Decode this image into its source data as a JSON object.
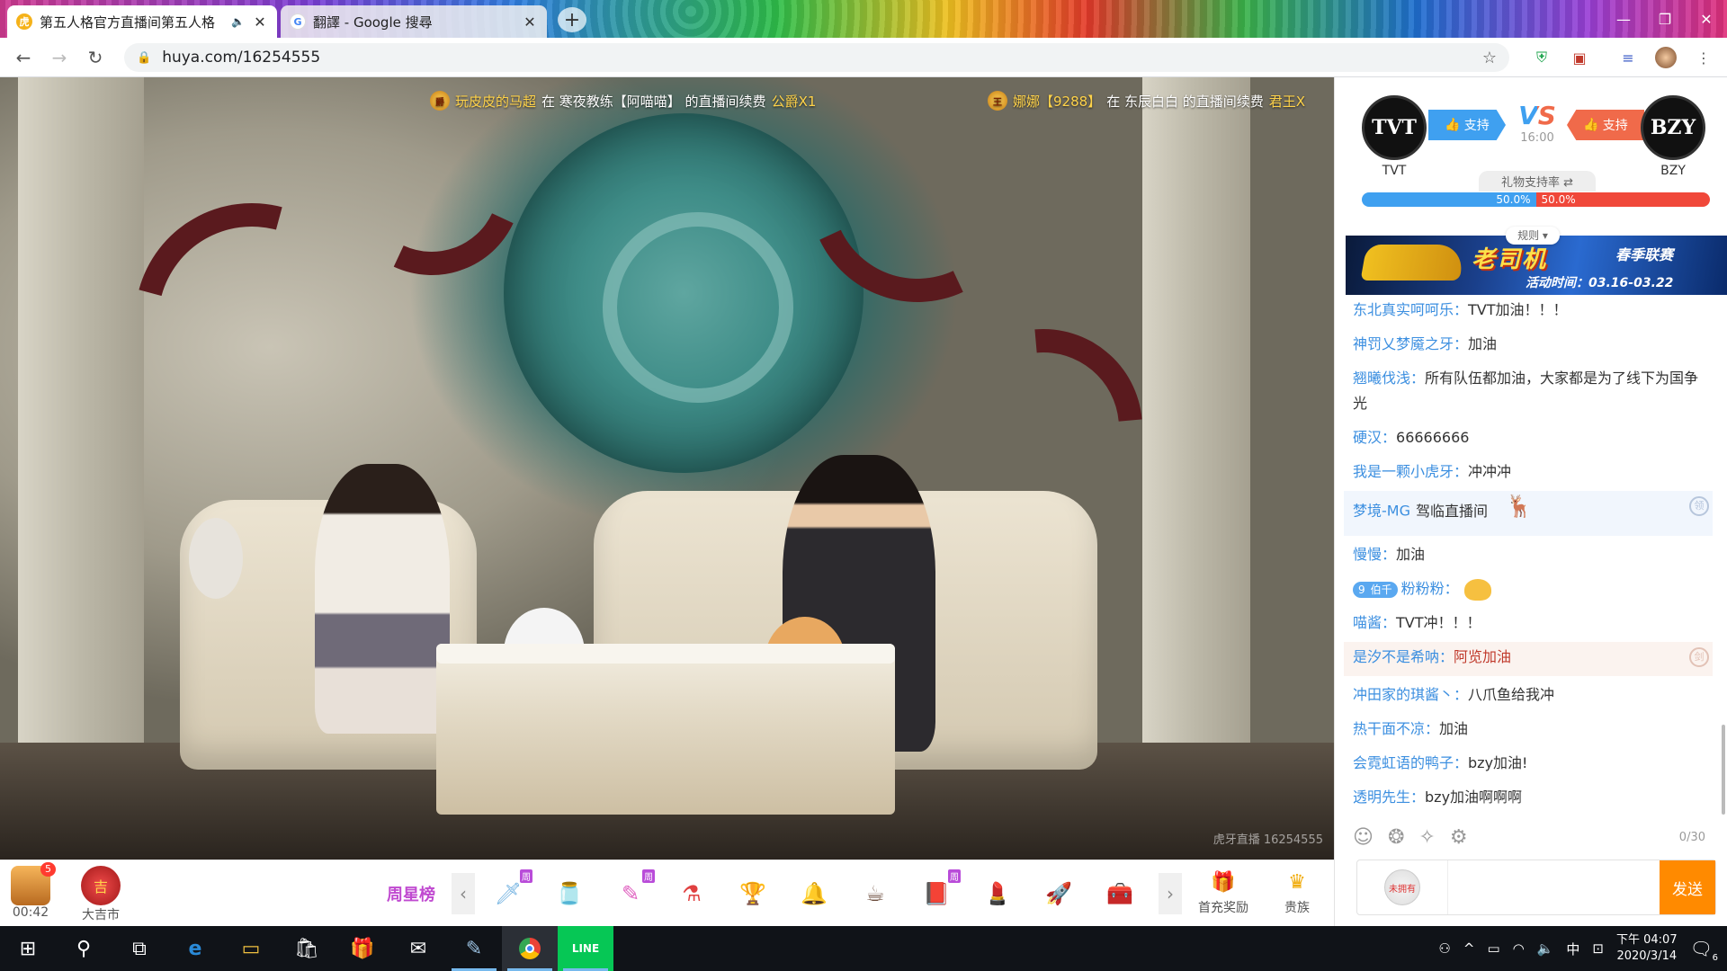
{
  "browser": {
    "tabs": [
      {
        "title": "第五人格官方直播间第五人格",
        "active": true
      },
      {
        "title": "翻譯 - Google 搜尋",
        "active": false
      }
    ],
    "url": "huya.com/16254555"
  },
  "video": {
    "tickers": [
      {
        "user": "玩皮皮的马超",
        "mid": "在 寒夜教练【阿喵喵】 的直播间续费",
        "gift": "公爵X1"
      },
      {
        "user": "娜娜【9288】",
        "mid": "在 东辰白白 的直播间续费",
        "gift": "君王X"
      }
    ],
    "watermark": "虎牙直播 16254555"
  },
  "giftbar": {
    "treasure_timer": "00:42",
    "treasure_badge": "5",
    "daji_label": "大吉市",
    "weekstar_label": "周星榜",
    "zhou_tag": "周",
    "first_recharge_label": "首充奖励",
    "noble_label": "贵族"
  },
  "match": {
    "team_left": "TVT",
    "team_right": "BZY",
    "support_label": "支持",
    "vs": "VS",
    "time": "16:00",
    "rate_label": "礼物支持率",
    "rate_left": "50.0%",
    "rate_right": "50.0%",
    "rate_left_fraction": 0.5,
    "rules_label": "规则",
    "colors": {
      "left": "#3fa0f0",
      "right": "#f06a4a"
    }
  },
  "banner": {
    "title": "老司机",
    "subtitle": "春季联赛",
    "date": "活动时间：03.16-03.22"
  },
  "chat": {
    "messages": [
      {
        "user": "东北真实呵呵乐：",
        "text": "TVT加油！！！"
      },
      {
        "user": "神罚乂梦魇之牙：",
        "text": "加油"
      },
      {
        "user": "翘曦伐浅：",
        "text": "所有队伍都加油，大家都是为了线下为国争光"
      },
      {
        "user": "硬汉：",
        "text": "66666666"
      },
      {
        "user": "我是一颗小虎牙：",
        "text": "冲冲冲"
      },
      {
        "user": "梦境-MG",
        "text": "驾临直播间",
        "type": "enter"
      },
      {
        "user": "慢慢：",
        "text": "加油"
      },
      {
        "user": "粉粉粉：",
        "text": "",
        "type": "fan",
        "badge_level": "9",
        "badge_name": "伯千"
      },
      {
        "user": "喵酱：",
        "text": "TVT冲！！！"
      },
      {
        "user": "是汐不是希呐：",
        "text": "阿览加油",
        "type": "noble"
      },
      {
        "user": "冲田家的琪酱丶：",
        "text": "八爪鱼给我冲"
      },
      {
        "user": "热干面不凉：",
        "text": "加油"
      },
      {
        "user": "会霓虹语的鸭子：",
        "text": "bzy加油!"
      },
      {
        "user": "透明先生：",
        "text": "bzy加油啊啊啊"
      }
    ],
    "count": "0/30",
    "noble_box_label": "未拥有",
    "input_value": "",
    "send_label": "发送"
  },
  "taskbar": {
    "time": "下午 04:07",
    "date": "2020/3/14",
    "ime": "中",
    "notification_count": "6"
  }
}
